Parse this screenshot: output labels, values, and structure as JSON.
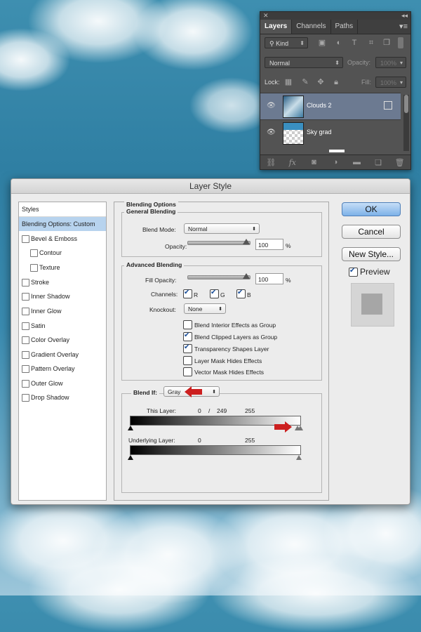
{
  "layers_panel": {
    "tabs": [
      "Layers",
      "Channels",
      "Paths"
    ],
    "filter_kind": "Kind",
    "blend_mode": "Normal",
    "opacity_label": "Opacity:",
    "opacity_value": "100%",
    "lock_label": "Lock:",
    "fill_label": "Fill:",
    "fill_value": "100%",
    "layers": [
      {
        "name": "Clouds 2",
        "selected": true
      },
      {
        "name": "Sky grad",
        "selected": false
      }
    ]
  },
  "dialog": {
    "title": "Layer Style",
    "styles_header": "Styles",
    "styles": [
      {
        "label": "Blending Options: Custom",
        "checkbox": false,
        "selected": true
      },
      {
        "label": "Bevel & Emboss",
        "checkbox": true
      },
      {
        "label": "Contour",
        "checkbox": true,
        "indent": true
      },
      {
        "label": "Texture",
        "checkbox": true,
        "indent": true
      },
      {
        "label": "Stroke",
        "checkbox": true
      },
      {
        "label": "Inner Shadow",
        "checkbox": true
      },
      {
        "label": "Inner Glow",
        "checkbox": true
      },
      {
        "label": "Satin",
        "checkbox": true
      },
      {
        "label": "Color Overlay",
        "checkbox": true
      },
      {
        "label": "Gradient Overlay",
        "checkbox": true
      },
      {
        "label": "Pattern Overlay",
        "checkbox": true
      },
      {
        "label": "Outer Glow",
        "checkbox": true
      },
      {
        "label": "Drop Shadow",
        "checkbox": true
      }
    ],
    "blending_options_title": "Blending Options",
    "general_blending": {
      "title": "General Blending",
      "blend_mode_label": "Blend Mode:",
      "blend_mode_value": "Normal",
      "opacity_label": "Opacity:",
      "opacity_value": "100",
      "opacity_unit": "%"
    },
    "advanced_blending": {
      "title": "Advanced Blending",
      "fill_opacity_label": "Fill Opacity:",
      "fill_opacity_value": "100",
      "fill_unit": "%",
      "channels_label": "Channels:",
      "channels": [
        "R",
        "G",
        "B"
      ],
      "knockout_label": "Knockout:",
      "knockout_value": "None",
      "options": [
        {
          "label": "Blend Interior Effects as Group",
          "checked": false
        },
        {
          "label": "Blend Clipped Layers as Group",
          "checked": true
        },
        {
          "label": "Transparency Shapes Layer",
          "checked": true
        },
        {
          "label": "Layer Mask Hides Effects",
          "checked": false
        },
        {
          "label": "Vector Mask Hides Effects",
          "checked": false
        }
      ]
    },
    "blend_if": {
      "label": "Blend If:",
      "value": "Gray",
      "this_layer_label": "This Layer:",
      "this_layer_low": "0",
      "this_layer_sep": "/",
      "this_layer_split": "249",
      "this_layer_high": "255",
      "underlying_label": "Underlying Layer:",
      "underlying_low": "0",
      "underlying_high": "255"
    },
    "buttons": {
      "ok": "OK",
      "cancel": "Cancel",
      "new_style": "New Style...",
      "preview": "Preview"
    }
  },
  "colors": {
    "accent_blue": "#7db1e8",
    "arrow_red": "#cc1f1f",
    "selection_blue": "#b7d3ee"
  }
}
